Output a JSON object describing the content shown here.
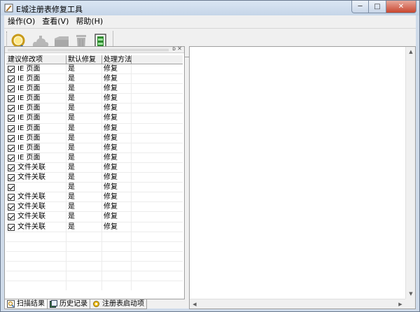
{
  "window": {
    "title": "E城注册表修复工具",
    "minimize_glyph": "─",
    "maximize_glyph": "□",
    "close_glyph": "✕"
  },
  "menu": [
    {
      "label": "操作(O)"
    },
    {
      "label": "查看(V)"
    },
    {
      "label": "帮助(H)"
    }
  ],
  "toolbar": {
    "buttons": [
      {
        "icon": "magnifier-scan-icon",
        "enabled": true
      },
      {
        "icon": "cloud-upload-icon",
        "enabled": false
      },
      {
        "icon": "folder-icon",
        "enabled": false
      },
      {
        "icon": "trash-icon",
        "enabled": false
      },
      {
        "icon": "battery-exit-icon",
        "enabled": true
      }
    ]
  },
  "grid": {
    "headers": [
      "建议修改项",
      "默认修复",
      "处理方法"
    ],
    "rows": [
      {
        "checked": true,
        "item": "IE 页面",
        "default_fix": "是",
        "method": "修复"
      },
      {
        "checked": true,
        "item": "IE 页面",
        "default_fix": "是",
        "method": "修复"
      },
      {
        "checked": true,
        "item": "IE 页面",
        "default_fix": "是",
        "method": "修复"
      },
      {
        "checked": true,
        "item": "IE 页面",
        "default_fix": "是",
        "method": "修复"
      },
      {
        "checked": true,
        "item": "IE 页面",
        "default_fix": "是",
        "method": "修复"
      },
      {
        "checked": true,
        "item": "IE 页面",
        "default_fix": "是",
        "method": "修复"
      },
      {
        "checked": true,
        "item": "IE 页面",
        "default_fix": "是",
        "method": "修复"
      },
      {
        "checked": true,
        "item": "IE 页面",
        "default_fix": "是",
        "method": "修复"
      },
      {
        "checked": true,
        "item": "IE 页面",
        "default_fix": "是",
        "method": "修复"
      },
      {
        "checked": true,
        "item": "IE 页面",
        "default_fix": "是",
        "method": "修复"
      },
      {
        "checked": true,
        "item": "文件关联",
        "default_fix": "是",
        "method": "修复"
      },
      {
        "checked": true,
        "item": "文件关联",
        "default_fix": "是",
        "method": "修复"
      },
      {
        "checked": true,
        "item": "",
        "default_fix": "是",
        "method": "修复"
      },
      {
        "checked": true,
        "item": "文件关联",
        "default_fix": "是",
        "method": "修复"
      },
      {
        "checked": true,
        "item": "文件关联",
        "default_fix": "是",
        "method": "修复"
      },
      {
        "checked": true,
        "item": "文件关联",
        "default_fix": "是",
        "method": "修复"
      },
      {
        "checked": true,
        "item": "文件关联",
        "default_fix": "是",
        "method": "修复"
      }
    ],
    "empty_rows": 6
  },
  "tabs": [
    {
      "label": "扫描结果",
      "icon": "scan-results-icon",
      "active": true
    },
    {
      "label": "历史记录",
      "icon": "history-icon",
      "active": false
    },
    {
      "label": "注册表启动项",
      "icon": "startup-gear-icon",
      "active": false
    }
  ],
  "colors": {
    "titlebar": "#c5d5e8",
    "close_button": "#c7462f",
    "window_bg": "#f0f0f0"
  }
}
